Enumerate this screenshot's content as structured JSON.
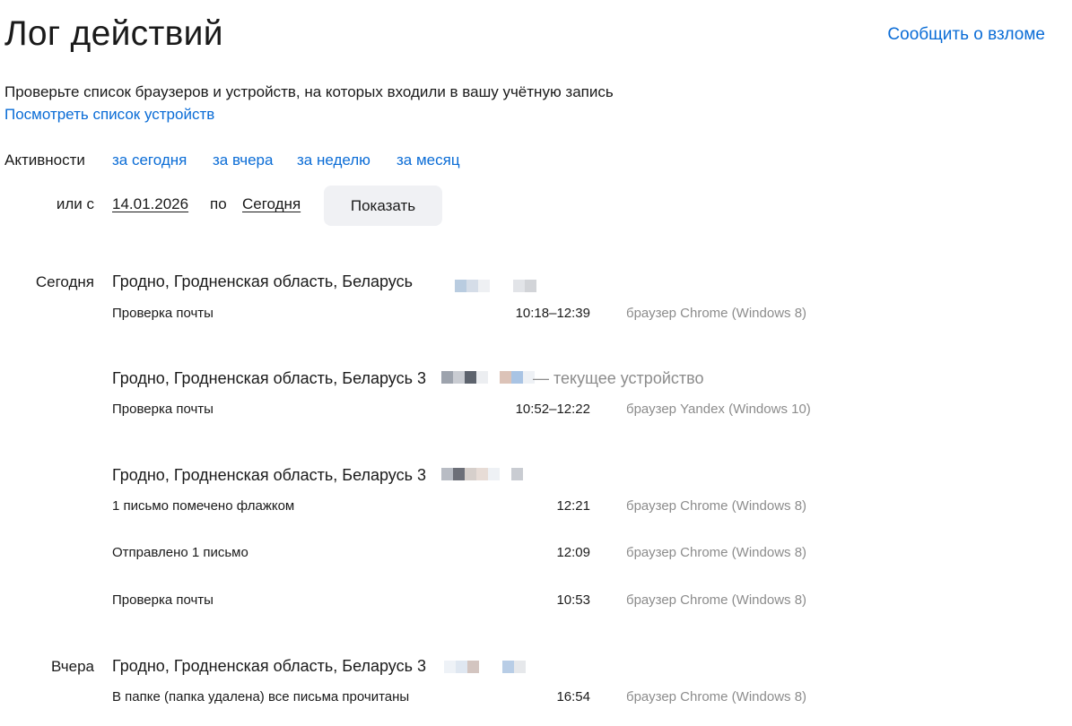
{
  "header": {
    "title": "Лог действий",
    "report_link": "Сообщить о взломе"
  },
  "intro": {
    "description": "Проверьте список браузеров и устройств, на которых входили в вашу учётную запись",
    "devices_link": "Посмотреть список устройств"
  },
  "filters": {
    "activity_label": "Активности",
    "periods": [
      "за сегодня",
      "за вчера",
      "за неделю",
      "за месяц"
    ],
    "or_from_label": "или с",
    "date_from": "14.01.2026",
    "to_label": "по",
    "date_to": "Сегодня",
    "show_button": "Показать"
  },
  "log": {
    "today_label": "Сегодня",
    "yesterday_label": "Вчера",
    "groups": [
      {
        "location": "Гродно, Гродненская область, Беларусь",
        "current_device": "",
        "entries": [
          {
            "action": "Проверка почты",
            "time": "10:18–12:39",
            "browser": "браузер Chrome (Windows 8)"
          }
        ]
      },
      {
        "location": "Гродно, Гродненская область, Беларусь 3",
        "current_device": "— текущее устройство",
        "entries": [
          {
            "action": "Проверка почты",
            "time": "10:52–12:22",
            "browser": "браузер Yandex (Windows 10)"
          }
        ]
      },
      {
        "location": "Гродно, Гродненская область, Беларусь 3",
        "current_device": "",
        "entries": [
          {
            "action": "1 письмо помечено флажком",
            "time": "12:21",
            "browser": "браузер Chrome (Windows 8)"
          },
          {
            "action": "Отправлено 1 письмо",
            "time": "12:09",
            "browser": "браузер Chrome (Windows 8)"
          },
          {
            "action": "Проверка почты",
            "time": "10:53",
            "browser": "браузер Chrome (Windows 8)"
          }
        ]
      },
      {
        "location": "Гродно, Гродненская область, Беларусь 3",
        "current_device": "",
        "entries": [
          {
            "action": "В папке (папка удалена) все письма прочитаны",
            "time": "16:54",
            "browser": "браузер Chrome (Windows 8)"
          }
        ]
      }
    ]
  },
  "colors": {
    "link": "#0a6cd6",
    "muted": "#8c8c8c",
    "button_bg": "#f0f1f4"
  }
}
